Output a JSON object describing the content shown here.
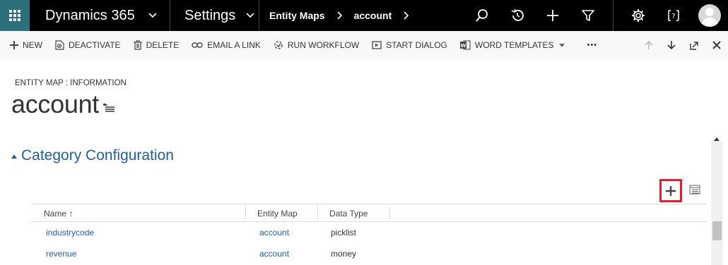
{
  "app": {
    "name": "Dynamics 365",
    "area": "Settings",
    "breadcrumbs": [
      "Entity Maps",
      "account"
    ]
  },
  "nav_icons": [
    "search-icon",
    "history-icon",
    "plus-icon",
    "filter-icon",
    "gear-icon",
    "help-icon",
    "user-avatar"
  ],
  "commands": {
    "new": "NEW",
    "deactivate": "DEACTIVATE",
    "delete": "DELETE",
    "email_link": "EMAIL A LINK",
    "run_workflow": "RUN WORKFLOW",
    "start_dialog": "START DIALOG",
    "word_templates": "WORD TEMPLATES",
    "more": "•••"
  },
  "header": {
    "entity_label": "ENTITY MAP : INFORMATION",
    "title": "account"
  },
  "section": {
    "title": "Category Configuration"
  },
  "grid": {
    "columns": [
      "Name ↑",
      "Entity Map",
      "Data Type"
    ],
    "rows": [
      {
        "name": "industrycode",
        "entity_map": "account",
        "data_type": "picklist"
      },
      {
        "name": "revenue",
        "entity_map": "account",
        "data_type": "money"
      }
    ]
  },
  "colors": {
    "nav_bg": "#000000",
    "waffle_bg": "#2a6f7a",
    "link": "#1f5fa3",
    "highlight": "#e0202a"
  }
}
